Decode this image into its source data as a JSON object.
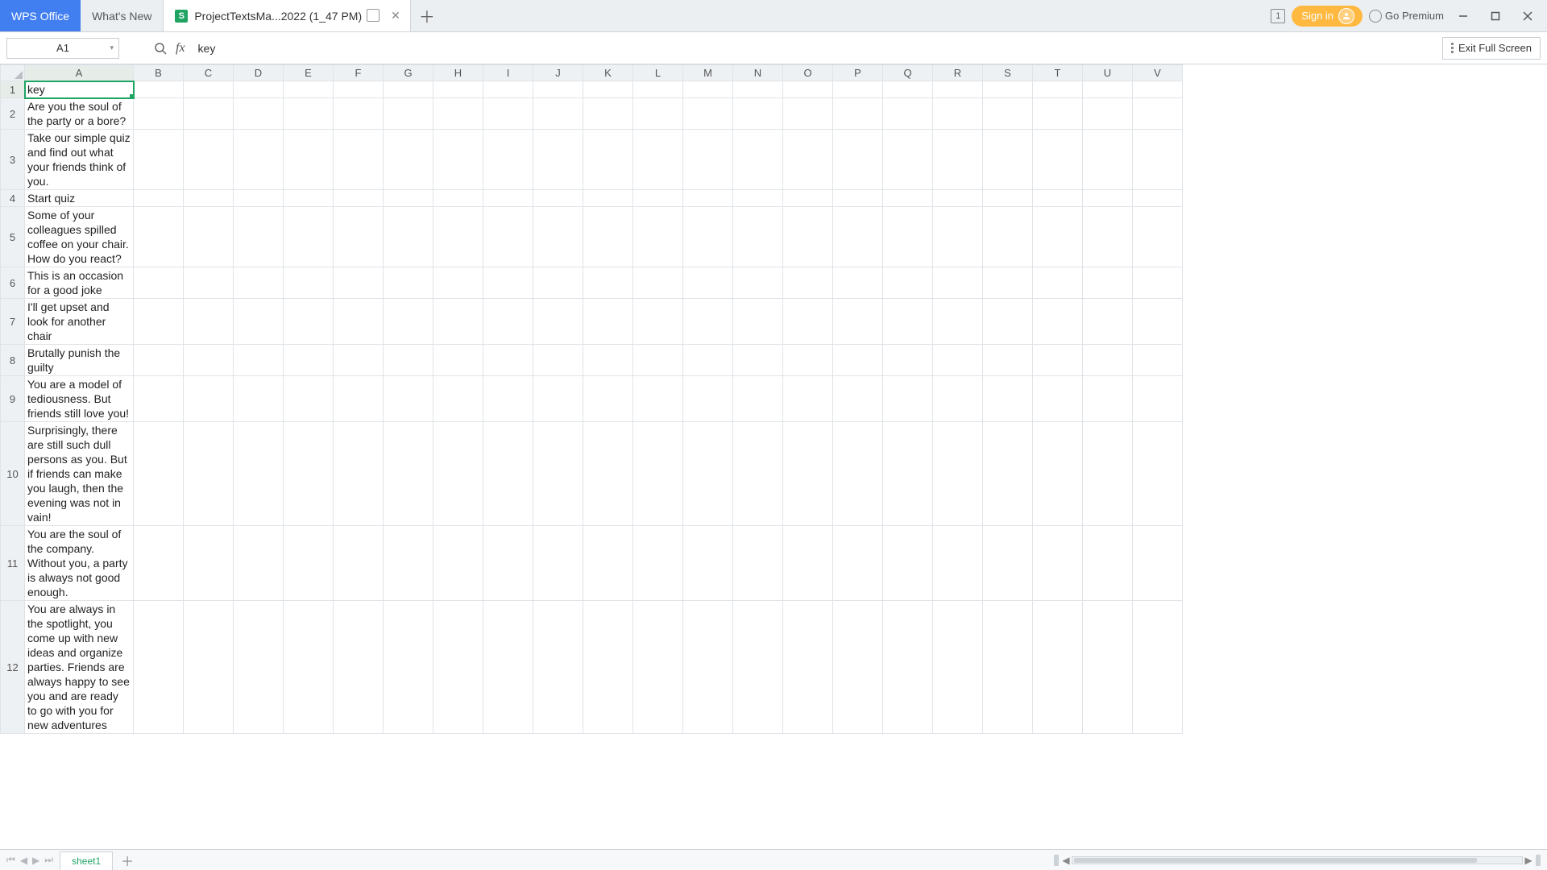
{
  "titlebar": {
    "app_tab": "WPS Office",
    "whatsnew_tab": "What's New",
    "active_tab": "ProjectTextsMa...2022 (1_47 PM)",
    "badge_one": "1",
    "signin": "Sign in",
    "premium": "Go Premium"
  },
  "formula_bar": {
    "name_box": "A1",
    "formula": "key",
    "exit_fs": "Exit Full Screen"
  },
  "sheet": {
    "columns": [
      "A",
      "B",
      "C",
      "D",
      "E",
      "F",
      "G",
      "H",
      "I",
      "J",
      "K",
      "L",
      "M",
      "N",
      "O",
      "P",
      "Q",
      "R",
      "S",
      "T",
      "U",
      "V"
    ],
    "rows": [
      "key",
      "Are you the soul of the party or a bore?",
      "Take our simple quiz and find out what your friends think of you.",
      "Start quiz",
      "Some of your colleagues spilled coffee on your chair. How do you react?",
      "This is an occasion for a good joke",
      "I'll get upset and look for another chair",
      "Brutally punish the guilty",
      "You are a model of tediousness. But friends still love you!",
      "Surprisingly, there are still such dull persons as you. But if friends can make you laugh, then the evening was not in vain!",
      "You are the soul of the company. Without you, a party is always not good enough.",
      "You are always in the spotlight, you come up with new ideas and organize parties. Friends are always happy to see you and are ready to go with you for new adventures"
    ]
  },
  "statusbar": {
    "sheet_tab": "sheet1"
  }
}
